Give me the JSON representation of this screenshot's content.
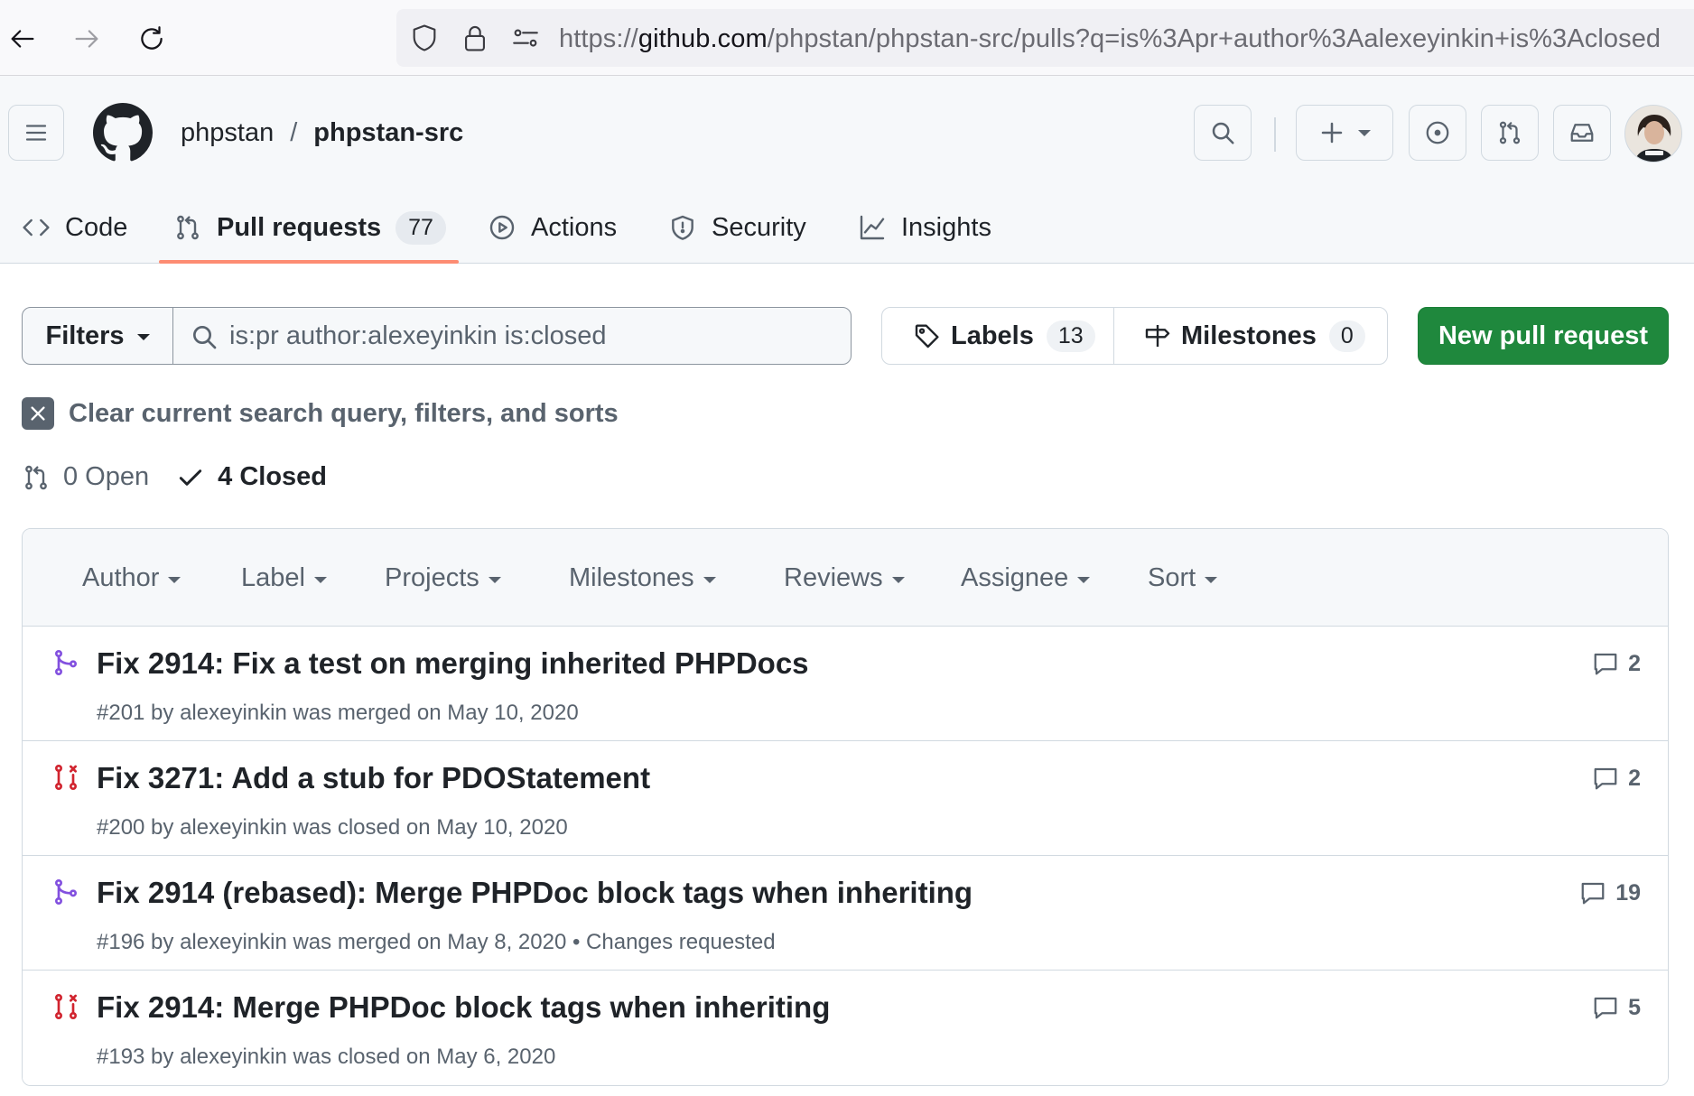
{
  "browser": {
    "url_prefix": "https://",
    "url_host": "github.com",
    "url_path": "/phpstan/phpstan-src/pulls?q=is%3Apr+author%3Aalexeyinkin+is%3Aclosed"
  },
  "header": {
    "owner": "phpstan",
    "separator": "/",
    "repo": "phpstan-src"
  },
  "tabs": [
    {
      "label": "Code",
      "icon": "code-icon"
    },
    {
      "label": "Pull requests",
      "count": "77",
      "icon": "git-pull-request-icon"
    },
    {
      "label": "Actions",
      "icon": "play-icon"
    },
    {
      "label": "Security",
      "icon": "shield-icon"
    },
    {
      "label": "Insights",
      "icon": "graph-icon"
    }
  ],
  "search": {
    "filters_label": "Filters",
    "query": "is:pr author:alexeyinkin is:closed",
    "labels_label": "Labels",
    "labels_count": "13",
    "milestones_label": "Milestones",
    "milestones_count": "0",
    "new_pr_label": "New pull request"
  },
  "clear_label": "Clear current search query, filters, and sorts",
  "states": {
    "open": "0 Open",
    "closed": "4 Closed"
  },
  "list_filters": [
    "Author",
    "Label",
    "Projects",
    "Milestones",
    "Reviews",
    "Assignee",
    "Sort"
  ],
  "colors": {
    "merged": "#8250df",
    "closed": "#d1242f",
    "primary_button": "#1f883d",
    "tab_underline": "#fd8c73"
  },
  "pull_requests": [
    {
      "state": "merged",
      "title": "Fix 2914: Fix a test on merging inherited PHPDocs",
      "meta": "#201 by alexeyinkin was merged on May 10, 2020",
      "comments": "2"
    },
    {
      "state": "closed",
      "title": "Fix 3271: Add a stub for PDOStatement",
      "meta": "#200 by alexeyinkin was closed on May 10, 2020",
      "comments": "2"
    },
    {
      "state": "merged",
      "title": "Fix 2914 (rebased): Merge PHPDoc block tags when inheriting",
      "meta": "#196 by alexeyinkin was merged on May 8, 2020 • Changes requested",
      "comments": "19"
    },
    {
      "state": "closed",
      "title": "Fix 2914: Merge PHPDoc block tags when inheriting",
      "meta": "#193 by alexeyinkin was closed on May 6, 2020",
      "comments": "5"
    }
  ]
}
